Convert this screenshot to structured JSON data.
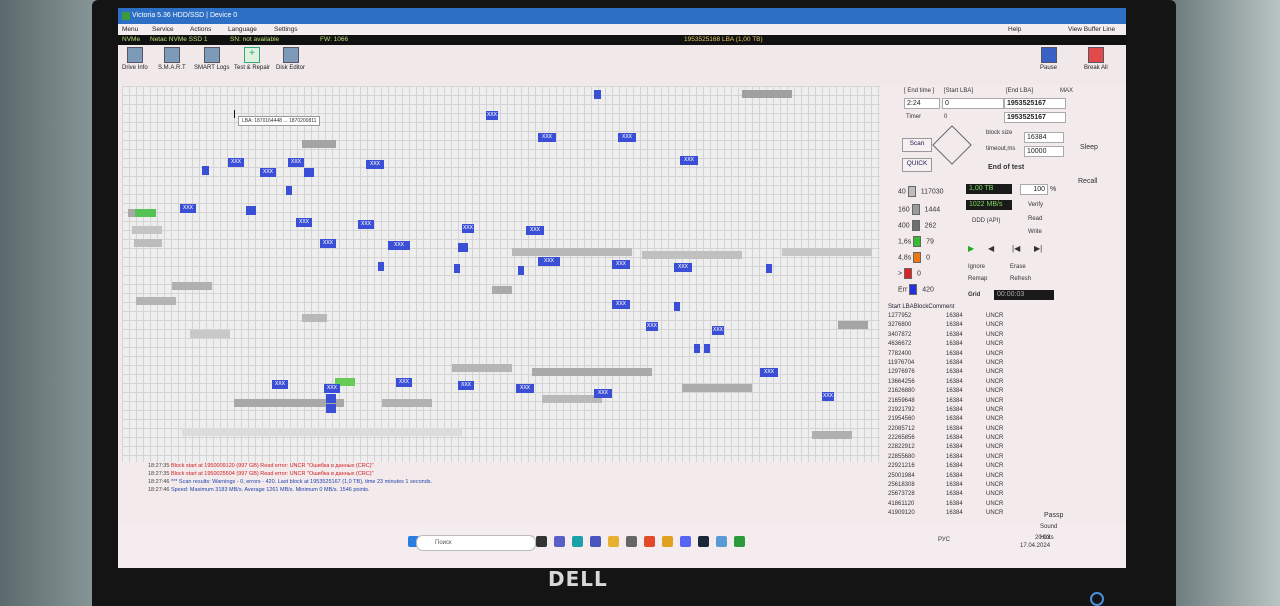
{
  "app": {
    "title": "Victoria 5.36 HDD/SSD | Device 0",
    "menu": [
      "Menu",
      "Service",
      "Actions",
      "Language",
      "Settings"
    ],
    "help": "Help",
    "view_buffer": "View Buffer Line"
  },
  "infobar": {
    "drive_type": "NVMe",
    "model": "Netac NVMe SSD 1",
    "sn": "SN: not available",
    "fw": "FW: 1066",
    "capacity": "1953525168 LBA (1,00 TB)"
  },
  "toolbar": {
    "items": [
      "Drive Info",
      "S.M.A.R.T",
      "SMART Logs",
      "Test & Repair",
      "Disk Editor"
    ],
    "pause": "Pause",
    "break_all": "Break All"
  },
  "map": {
    "tooltip": "LBA: 1870164448 ... 1870200811",
    "bad_label": "XXX"
  },
  "log": [
    {
      "time": "18:27:35",
      "text": "Block start at 1950009120 (997 GB) Read error: UNCR \"Ошибка в данных (CRC)\"",
      "color": "#cc2222"
    },
    {
      "time": "18:27:35",
      "text": "Block start at 1950025504 (997 GB) Read error: UNCR \"Ошибка в данных (CRC)\"",
      "color": "#cc2222"
    },
    {
      "time": "18:27:46",
      "text": "*** Scan results: Warnings - 0, errors - 420. Last block at 1953525167 (1,0 TB), time 23 minutes 1 seconds.",
      "color": "#2244aa"
    },
    {
      "time": "18:27:46",
      "text": "Speed: Maximum 3183 MB/s. Average 1261 MB/s. Minimum 0 MB/s. 1546 points.",
      "color": "#2244aa"
    }
  ],
  "panel": {
    "end_time_label": "[ End time ]",
    "start_lba_label": "[Start LBA]",
    "end_lba_label": "[End LBA]",
    "max_label": "MAX",
    "end_time": "2:24",
    "start_lba": "0",
    "end_lba": "1953525167",
    "timer_label": "Timer",
    "timer_value": "0",
    "timer_lba": "1953525167",
    "scan": "Scan",
    "quick": "QUICK",
    "block_size_label": "block size",
    "block_size": "16384",
    "timeout_label": "timeout,ms",
    "timeout": "10000",
    "status": "End of test",
    "counters": [
      {
        "label": "40",
        "value": "117030",
        "color": "#bdbdbd"
      },
      {
        "label": "160",
        "value": "1444",
        "color": "#9a9a9a"
      },
      {
        "label": "400",
        "value": "262",
        "color": "#707070"
      },
      {
        "label": "1,6s",
        "value": "79",
        "color": "#33bb33"
      },
      {
        "label": "4,8s",
        "value": "0",
        "color": "#ee7711"
      },
      {
        "label": ">",
        "value": "0",
        "color": "#dd2222"
      },
      {
        "label": "Err",
        "value": "420",
        "color": "#2233dd"
      }
    ],
    "size_done": "1,00 TB",
    "percent": "100",
    "percent_sign": "%",
    "speed": "1022 MB/s",
    "ddd_api": "DDD (API)",
    "modes": [
      "Verify",
      "Read",
      "Write"
    ],
    "actions": [
      "Ignore",
      "Erase",
      "Remap",
      "Refresh"
    ],
    "grid": "Grid",
    "grid_value": "00:00:03",
    "table_headers": [
      "Start LBA",
      "Block",
      "Comment"
    ],
    "table_rows": [
      [
        "1277952",
        "16384",
        "UNCR"
      ],
      [
        "3276800",
        "16384",
        "UNCR"
      ],
      [
        "3407872",
        "16384",
        "UNCR"
      ],
      [
        "4636672",
        "16384",
        "UNCR"
      ],
      [
        "7782400",
        "16384",
        "UNCR"
      ],
      [
        "11976704",
        "16384",
        "UNCR"
      ],
      [
        "12976976",
        "16384",
        "UNCR"
      ],
      [
        "13664256",
        "16384",
        "UNCR"
      ],
      [
        "21626880",
        "16384",
        "UNCR"
      ],
      [
        "21659648",
        "16384",
        "UNCR"
      ],
      [
        "21921792",
        "16384",
        "UNCR"
      ],
      [
        "21954560",
        "16384",
        "UNCR"
      ],
      [
        "22085712",
        "16384",
        "UNCR"
      ],
      [
        "22265856",
        "16384",
        "UNCR"
      ],
      [
        "22822912",
        "16384",
        "UNCR"
      ],
      [
        "22855680",
        "16384",
        "UNCR"
      ],
      [
        "22921216",
        "16384",
        "UNCR"
      ],
      [
        "25001984",
        "16384",
        "UNCR"
      ],
      [
        "25618308",
        "16384",
        "UNCR"
      ],
      [
        "25673728",
        "16384",
        "UNCR"
      ],
      [
        "41861120",
        "16384",
        "UNCR"
      ],
      [
        "41909120",
        "16384",
        "UNCR"
      ]
    ],
    "sleep": "Sleep",
    "recall": "Recall",
    "passp": "Passp",
    "sound": "Sound",
    "hints": "Hints"
  },
  "taskbar": {
    "search": "Поиск",
    "lang": "РУС",
    "time": "20:03",
    "date": "17.04.2024"
  },
  "monitor": {
    "brand": "DELL"
  }
}
